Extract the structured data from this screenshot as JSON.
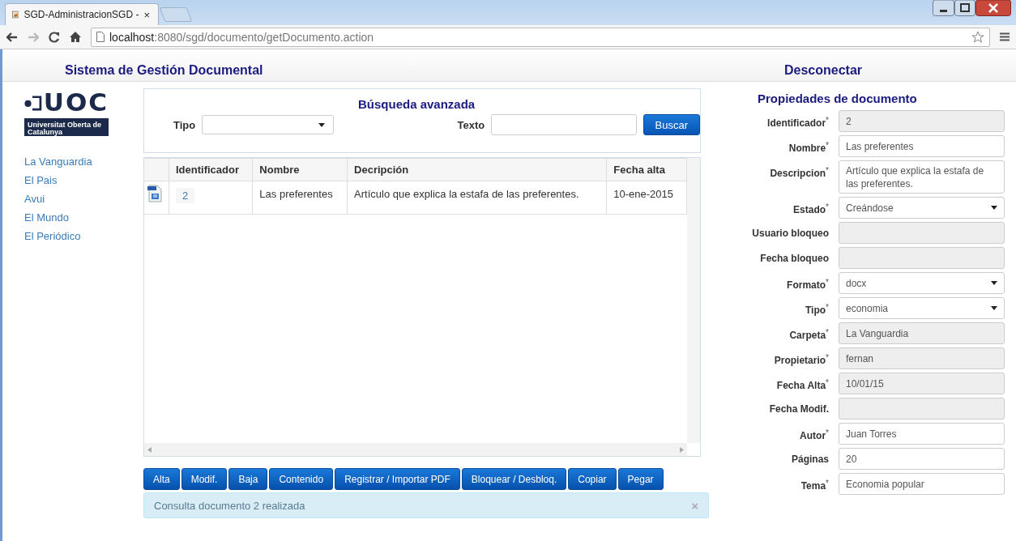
{
  "browser": {
    "tab_title": "SGD-AdministracionSGD -",
    "tab_close": "×",
    "url_host": "localhost",
    "url_path": ":8080/sgd/documento/getDocumento.action"
  },
  "header": {
    "title": "Sistema de Gestión Documental",
    "logout": "Desconectar"
  },
  "logo": {
    "mark": "UOC",
    "caption": "Universitat Oberta de Catalunya"
  },
  "sidebar": {
    "items": [
      {
        "label": "La Vanguardia"
      },
      {
        "label": "El Pais"
      },
      {
        "label": "Avui"
      },
      {
        "label": "El Mundo"
      },
      {
        "label": "El Periódico"
      }
    ]
  },
  "search": {
    "title": "Búsqueda avanzada",
    "type_label": "Tipo",
    "text_label": "Texto",
    "button": "Buscar"
  },
  "table": {
    "columns": [
      "Identificador",
      "Nombre",
      "Decripción",
      "Fecha alta"
    ],
    "rows": [
      {
        "cells": [
          "2",
          "Las preferentes",
          "Artículo que explica la estafa de las preferentes.",
          "10-ene-2015"
        ]
      }
    ]
  },
  "toolbar": {
    "buttons": [
      "Alta",
      "Modif.",
      "Baja",
      "Contenido",
      "Registrar / Importar PDF",
      "Bloquear / Desbloq.",
      "Copiar",
      "Pegar"
    ]
  },
  "alert": {
    "message": "Consulta documento 2 realizada",
    "close": "×"
  },
  "properties": {
    "title": "Propiedades de documento",
    "fields": [
      {
        "label": "Identificador$^{*}$",
        "kind": "input",
        "disabled": true,
        "value": "2"
      },
      {
        "label": "Nombre$^{*}$",
        "kind": "input",
        "disabled": false,
        "value": "Las preferentes"
      },
      {
        "label": "Descripcion$^{*}$",
        "kind": "textarea",
        "disabled": false,
        "value": "Artículo que explica la estafa de las preferentes."
      },
      {
        "label": "Estado$^{*}$",
        "kind": "select",
        "disabled": false,
        "value": "Creándose"
      },
      {
        "label": "Usuario bloqueo",
        "kind": "input",
        "disabled": true
      },
      {
        "label": "Fecha bloqueo",
        "kind": "input",
        "disabled": true
      },
      {
        "label": "Formato$^{*}$",
        "kind": "select",
        "disabled": false,
        "value": "docx"
      },
      {
        "label": "Tipo$^{*}$",
        "kind": "select",
        "disabled": false,
        "value": "economia"
      },
      {
        "label": "Carpeta$^{*}$",
        "kind": "input",
        "disabled": true,
        "value": "La Vanguardia"
      },
      {
        "label": "Propietario$^{*}$",
        "kind": "input",
        "disabled": true,
        "value": "fernan"
      },
      {
        "label": "Fecha Alta$^{*}$",
        "kind": "input",
        "disabled": true,
        "value": "10/01/15"
      },
      {
        "label": "Fecha Modif.",
        "kind": "input",
        "disabled": true
      },
      {
        "label": "Autor$^{*}$",
        "kind": "input",
        "disabled": false,
        "value": "Juan Torres"
      },
      {
        "label": "Páginas",
        "kind": "input",
        "disabled": false,
        "value": "20"
      },
      {
        "label": "Tema$^{*}$",
        "kind": "input",
        "disabled": false,
        "value": "Economia popular"
      }
    ]
  }
}
